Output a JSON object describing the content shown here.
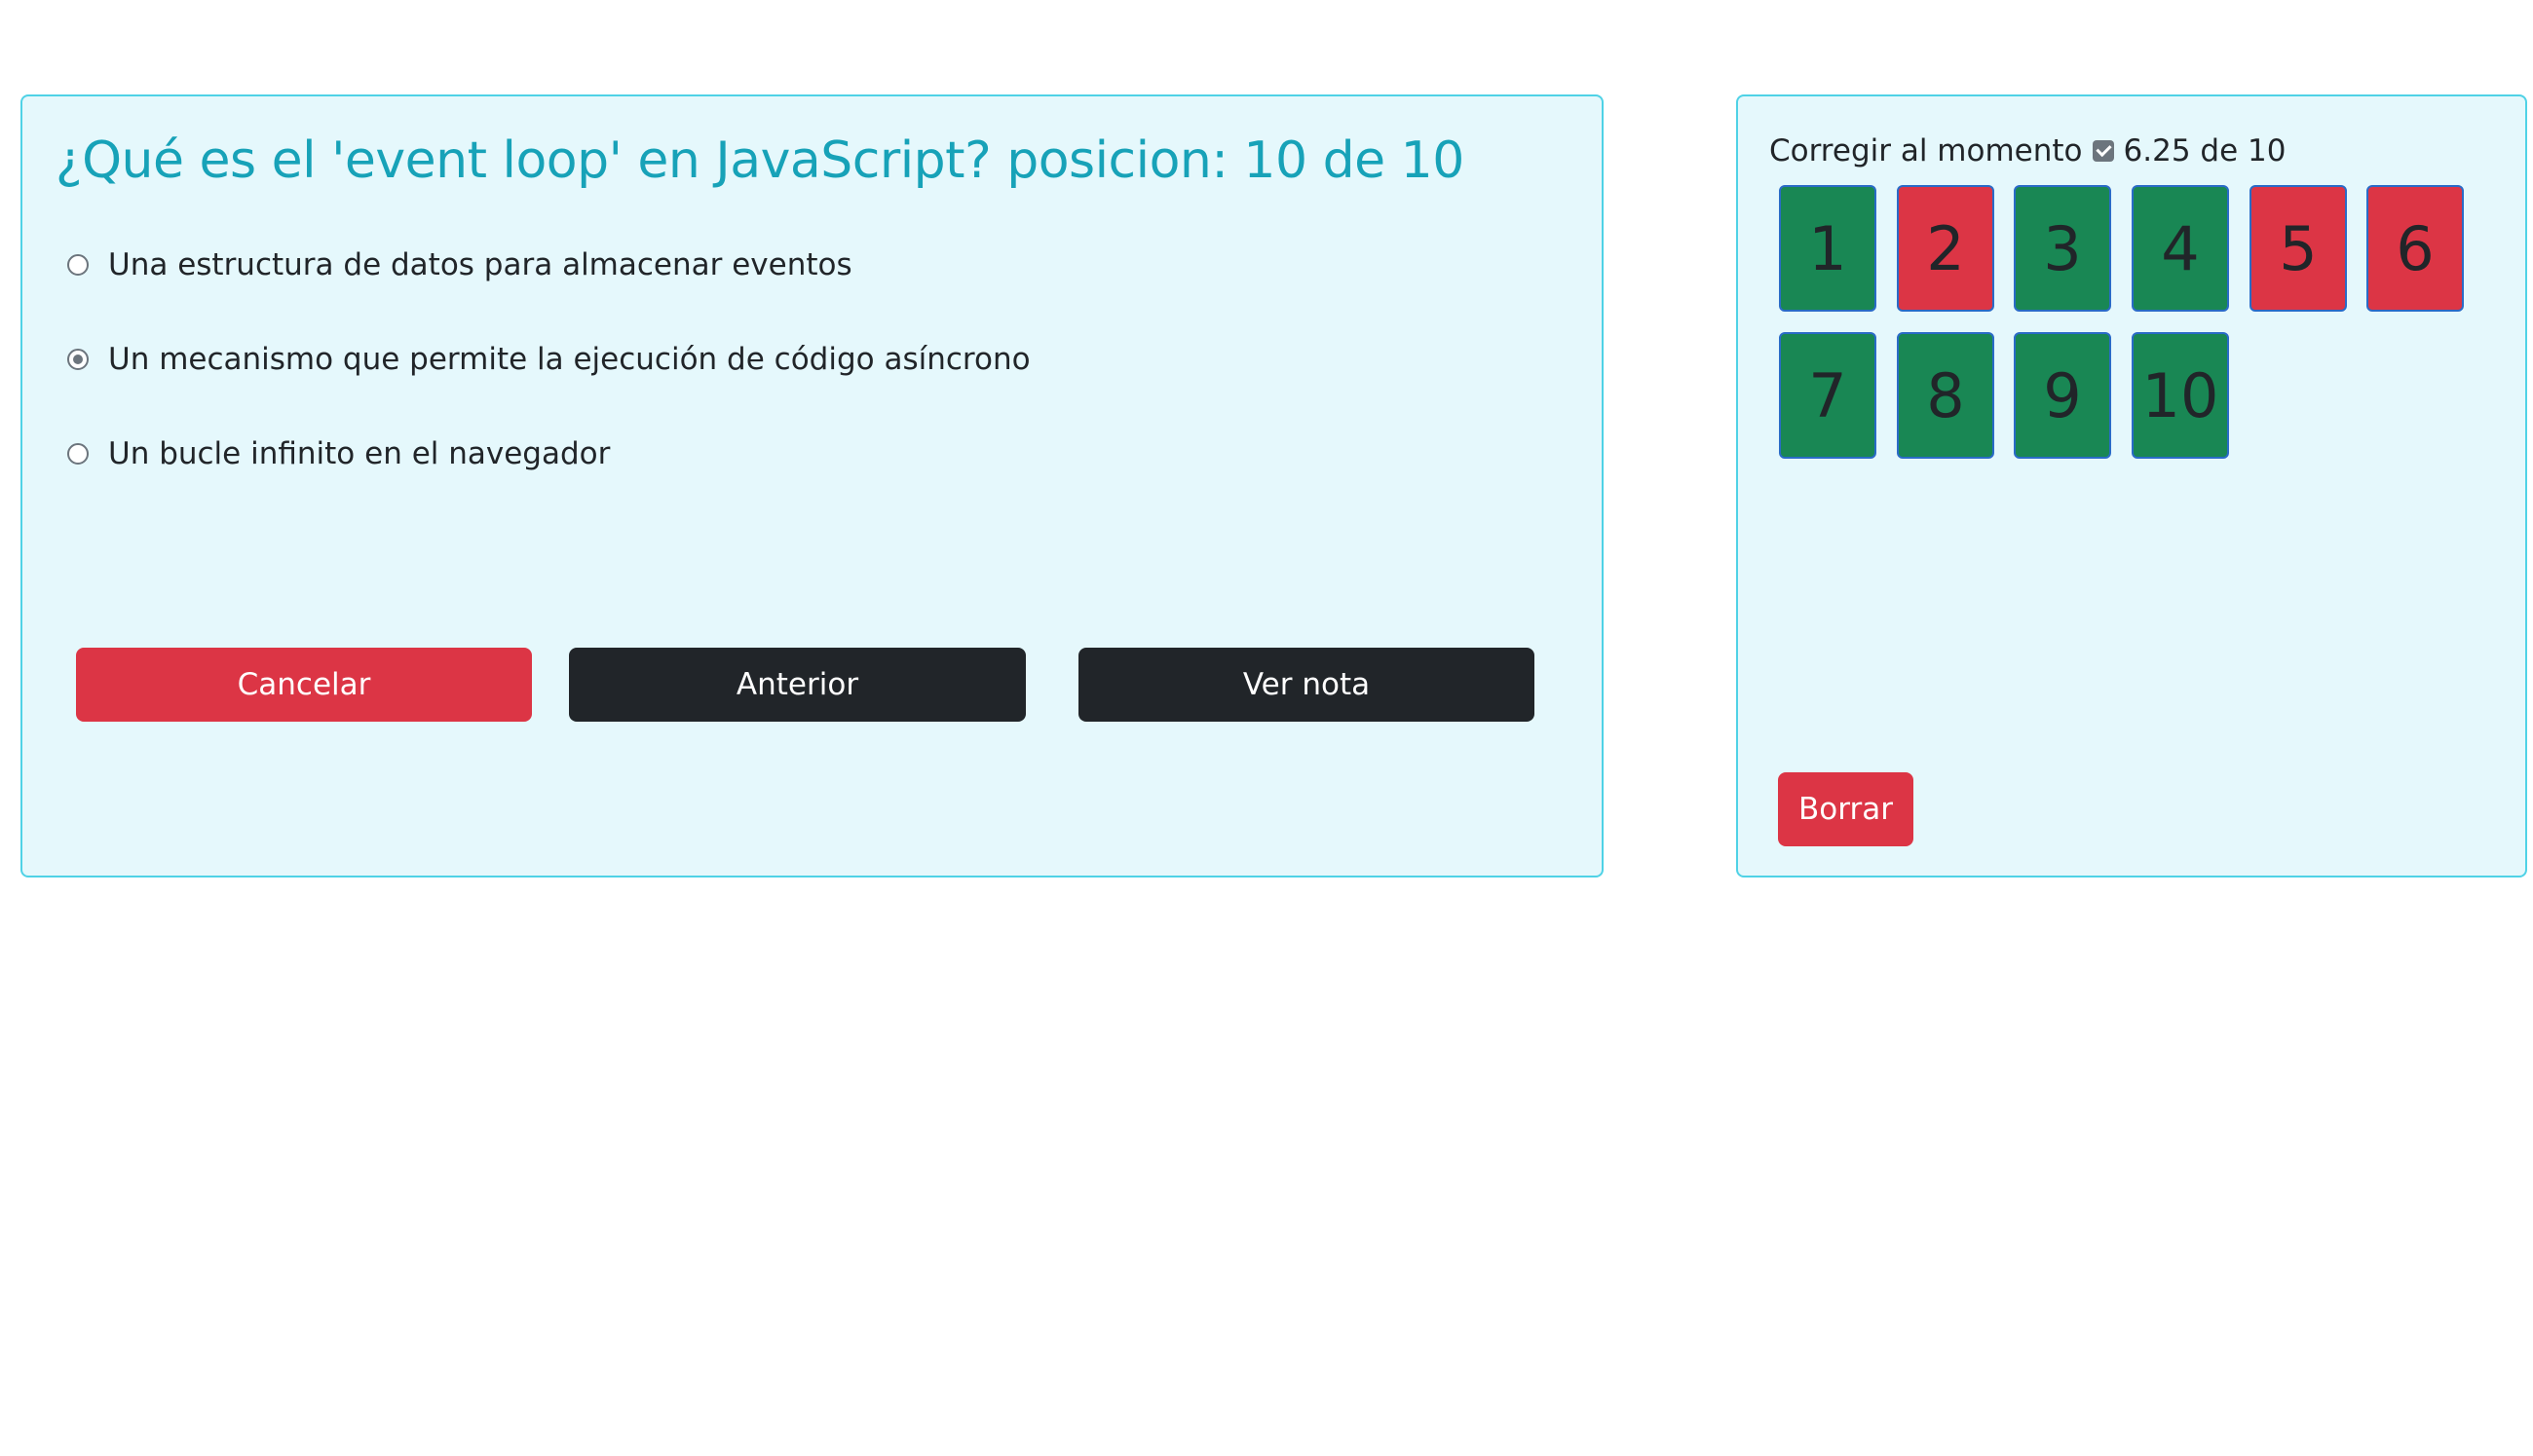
{
  "question": {
    "title": "¿Qué es el 'event loop' en JavaScript? posicion: 10 de 10",
    "options": [
      {
        "label": "Una estructura de datos para almacenar eventos",
        "selected": false
      },
      {
        "label": "Un mecanismo que permite la ejecución de código asíncrono",
        "selected": true
      },
      {
        "label": "Un bucle infinito en el navegador",
        "selected": false
      }
    ],
    "buttons": {
      "cancel": "Cancelar",
      "previous": "Anterior",
      "grade": "Ver nota"
    }
  },
  "navigator": {
    "correct_label": "Corregir al momento",
    "correct_checked": true,
    "score": "6.25 de 10",
    "questions": [
      {
        "number": "1",
        "status": "correct"
      },
      {
        "number": "2",
        "status": "incorrect"
      },
      {
        "number": "3",
        "status": "correct"
      },
      {
        "number": "4",
        "status": "correct"
      },
      {
        "number": "5",
        "status": "incorrect"
      },
      {
        "number": "6",
        "status": "incorrect"
      },
      {
        "number": "7",
        "status": "correct"
      },
      {
        "number": "8",
        "status": "correct"
      },
      {
        "number": "9",
        "status": "correct"
      },
      {
        "number": "10",
        "status": "correct"
      }
    ],
    "clear_button": "Borrar"
  },
  "colors": {
    "correct": "#198754",
    "incorrect": "#dc3545",
    "title": "#17a2b8",
    "card_bg": "#e5f8fc",
    "card_border": "#4fd2e6"
  }
}
